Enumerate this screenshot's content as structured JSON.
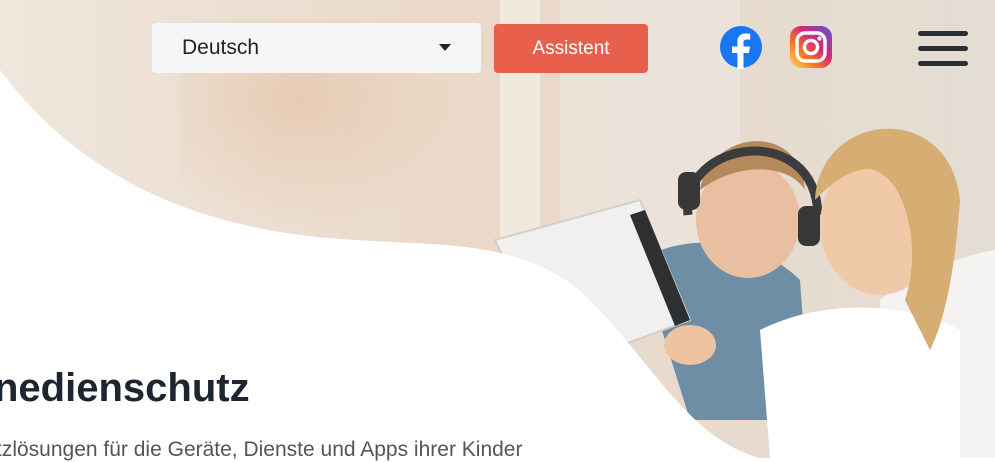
{
  "header": {
    "language_select": {
      "value": "Deutsch"
    },
    "assistant_button": {
      "label": "Assistent"
    },
    "social": [
      {
        "icon": "facebook-icon",
        "color": "#1877f2"
      },
      {
        "icon": "instagram-icon",
        "color": "#e1306c"
      }
    ],
    "menu_icon": "hamburger-menu-icon"
  },
  "hero": {
    "title": "nedienschutz",
    "subtitle": "tzlösungen für die Geräte, Dienste und Apps ihrer Kinder",
    "image": "children-with-tablet-photo"
  },
  "colors": {
    "accent": "#e8604c",
    "select_bg": "#f4f6f8",
    "title": "#1d2530",
    "text": "#555555"
  }
}
